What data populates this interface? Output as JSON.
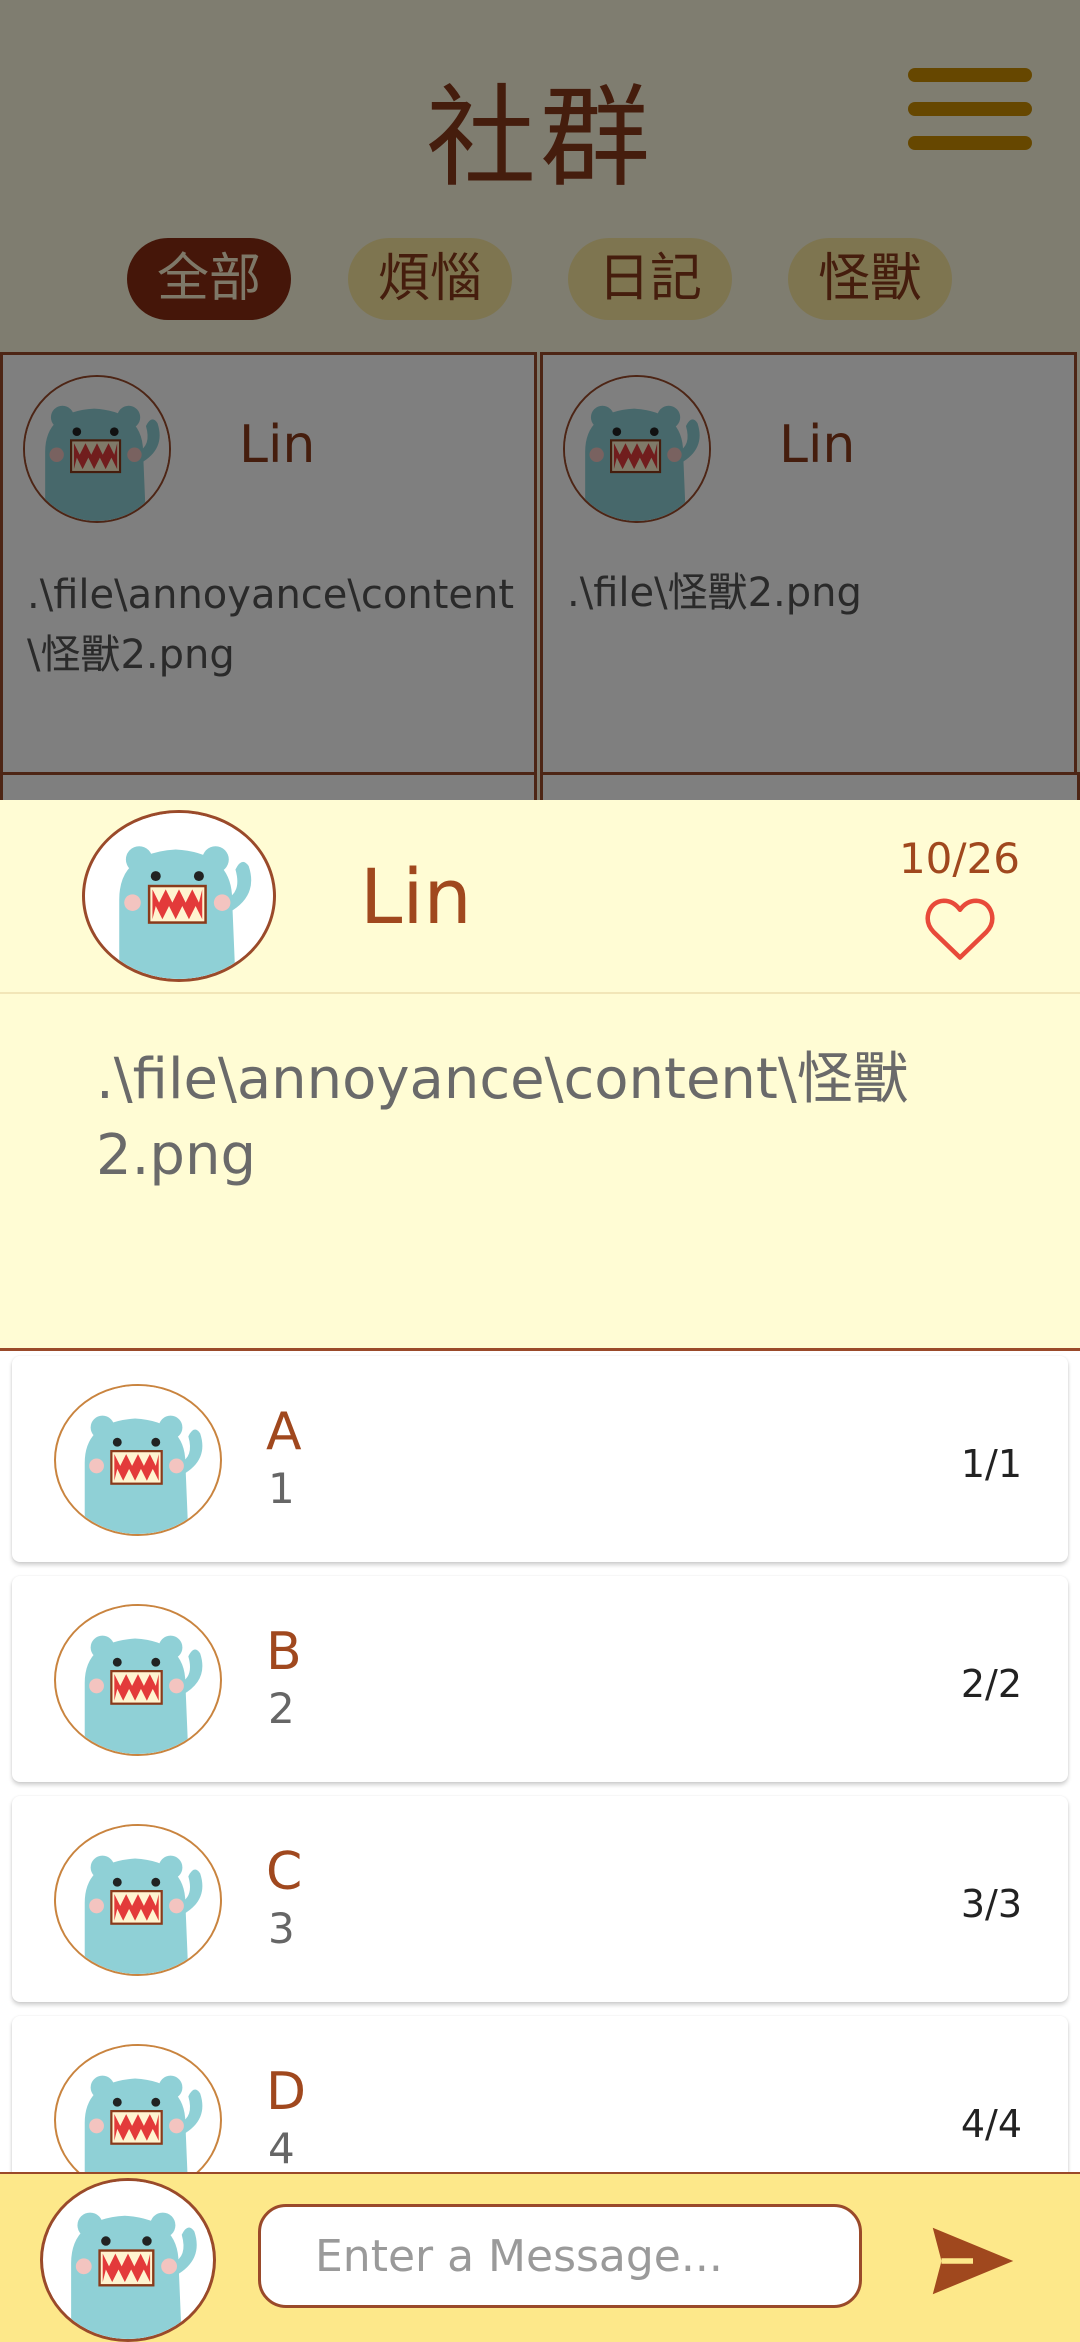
{
  "header": {
    "title": "社群",
    "tabs": [
      {
        "label": "全部",
        "active": true
      },
      {
        "label": "煩惱",
        "active": false
      },
      {
        "label": "日記",
        "active": false
      },
      {
        "label": "怪獸",
        "active": false
      }
    ]
  },
  "grid": {
    "cells": [
      {
        "name": "Lin",
        "text": ".\\file\\annoyance\\content\\怪獸2.png"
      },
      {
        "name": "Lin",
        "text": ".\\file\\怪獸2.png"
      }
    ]
  },
  "post": {
    "author": "Lin",
    "likes": "10/26",
    "content": ".\\file\\annoyance\\content\\怪獸2.png"
  },
  "comments": [
    {
      "name": "A",
      "message": "1",
      "time": "1/1"
    },
    {
      "name": "B",
      "message": "2",
      "time": "2/2"
    },
    {
      "name": "C",
      "message": "3",
      "time": "3/3"
    },
    {
      "name": "D",
      "message": "4",
      "time": "4/4"
    }
  ],
  "composer": {
    "placeholder": "Enter a Message...",
    "send_icon": "send-icon"
  },
  "colors": {
    "brown": "#8a3a1a",
    "cream": "#fffcd4",
    "yellow_bar": "#fde88a",
    "menu": "#cc8f00",
    "heart": "#e84a3a"
  }
}
